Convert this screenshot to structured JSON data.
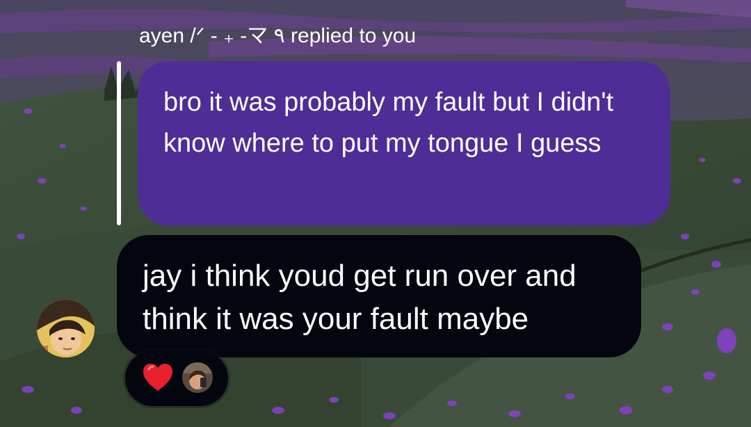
{
  "thread": {
    "reply_header": "ayen /ᐟ - ₊ -マ ٩ replied to you",
    "replied_message": "bro it was probably my fault but I didn't know where to put my tongue I guess",
    "message": "jay i think youd get run over and think it was your fault maybe"
  },
  "reactions": [
    {
      "emoji": "❤️",
      "icon": "heart-icon"
    }
  ],
  "colors": {
    "replied_bubble": "#4e2d96",
    "message_bubble": "#04060f",
    "reply_bar": "#ffffff",
    "text": "#ffffff",
    "heart": "#e8202e"
  }
}
